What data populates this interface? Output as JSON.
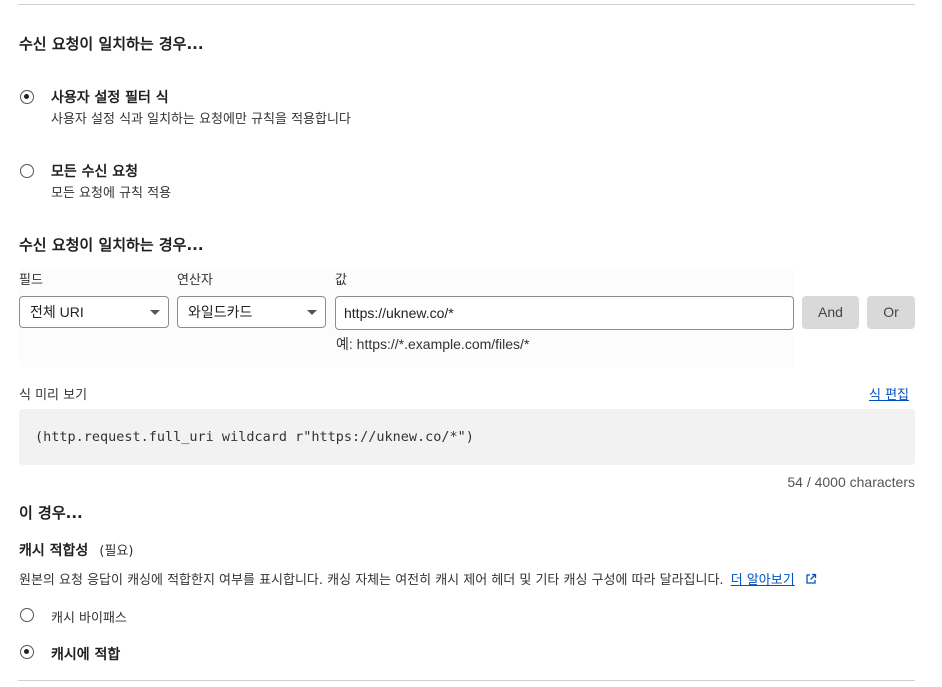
{
  "section1": {
    "title": "수신 요청이 일치하는 경우...",
    "options": [
      {
        "label": "사용자 설정 필터 식",
        "description": "사용자 설정 식과 일치하는 요청에만 규칙을 적용합니다",
        "selected": true
      },
      {
        "label": "모든 수신 요청",
        "description": "모든 요청에 규칙 적용",
        "selected": false
      }
    ]
  },
  "section2": {
    "title": "수신 요청이 일치하는 경우...",
    "field_label": "필드",
    "operator_label": "연산자",
    "value_label": "값",
    "field_value": "전체 URI",
    "operator_value": "와일드카드",
    "value_input": "https://uknew.co/*",
    "example": "예: https://*.example.com/files/*",
    "and_label": "And",
    "or_label": "Or"
  },
  "preview": {
    "label": "식 미리 보기",
    "edit_link": "식 편집",
    "expression": "(http.request.full_uri wildcard r\"https://uknew.co/*\")",
    "char_count": "54 / 4000 characters"
  },
  "then": {
    "title": "이 경우...",
    "cache_title": "캐시 적합성",
    "required": "(필요)",
    "description": "원본의 요청 응답이 캐싱에 적합한지 여부를 표시합니다. 캐싱 자체는 여전히 캐시 제어 헤더 및 기타 캐싱 구성에 따라 달라집니다.",
    "learn_more": "더 알아보기",
    "options": [
      {
        "label": "캐시 바이패스",
        "selected": false
      },
      {
        "label": "캐시에 적합",
        "selected": true
      }
    ]
  }
}
